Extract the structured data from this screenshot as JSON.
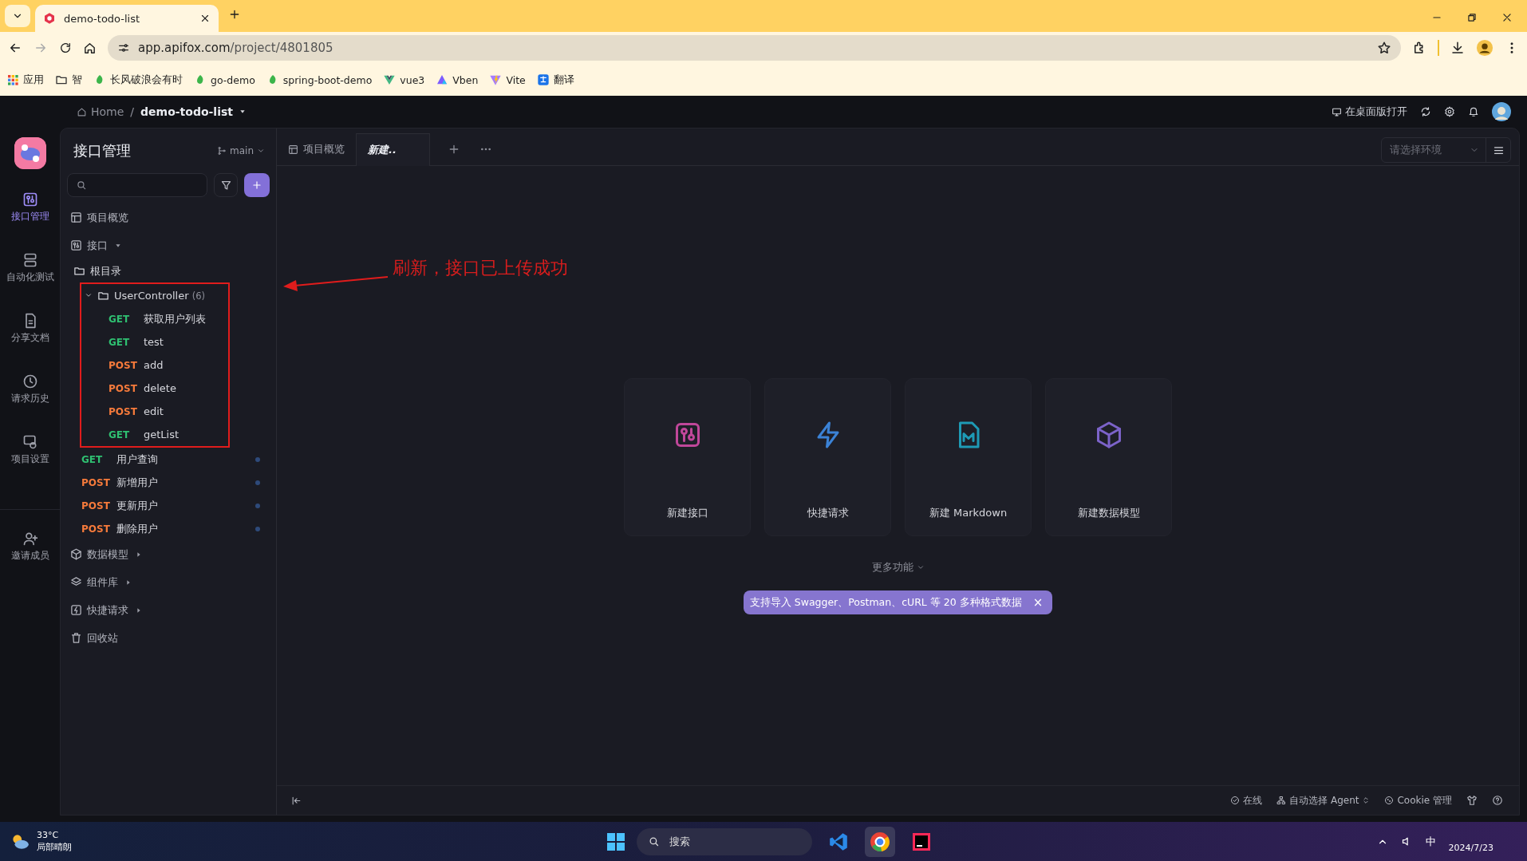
{
  "browser": {
    "tabs": [
      {
        "title": "demo-todo-list",
        "selected": true
      }
    ],
    "address": {
      "host": "app.apifox.com",
      "path": "/project/4801805"
    },
    "bookmarks": [
      {
        "label": "应用",
        "kind": "apps"
      },
      {
        "label": "智",
        "kind": "folder"
      },
      {
        "label": "长风破浪会有时",
        "kind": "leaf"
      },
      {
        "label": "go-demo",
        "kind": "leaf"
      },
      {
        "label": "spring-boot-demo",
        "kind": "leaf"
      },
      {
        "label": "vue3",
        "kind": "vue"
      },
      {
        "label": "Vben",
        "kind": "vben"
      },
      {
        "label": "Vite",
        "kind": "vite"
      },
      {
        "label": "翻译",
        "kind": "translate"
      }
    ]
  },
  "header": {
    "home": "Home",
    "separator": "/",
    "project": "demo-todo-list",
    "open_desktop": "在桌面版打开"
  },
  "rail": [
    {
      "label": "接口管理",
      "selected": true
    },
    {
      "label": "自动化测试",
      "selected": false
    },
    {
      "label": "分享文档",
      "selected": false
    },
    {
      "label": "请求历史",
      "selected": false
    },
    {
      "label": "项目设置",
      "selected": false
    },
    {
      "label": "邀请成员",
      "selected": false
    }
  ],
  "panel": {
    "title": "接口管理",
    "branch": "main",
    "nav": [
      {
        "label": "项目概览"
      },
      {
        "label": "接口",
        "expanded": true,
        "tree": [
          {
            "label": "根目录",
            "kind": "folder",
            "children": [
              {
                "label": "UserController",
                "count": "(6)",
                "kind": "folder",
                "expanded": true,
                "highlighted": true,
                "children": [
                  {
                    "kind": "endpoint",
                    "method": "GET",
                    "color": "#2fbf71",
                    "label": "获取用户列表",
                    "marked": false
                  },
                  {
                    "kind": "endpoint",
                    "method": "GET",
                    "color": "#2fbf71",
                    "label": "test",
                    "marked": false
                  },
                  {
                    "kind": "endpoint",
                    "method": "POST",
                    "color": "#f57a3b",
                    "label": "add",
                    "marked": false
                  },
                  {
                    "kind": "endpoint",
                    "method": "POST",
                    "color": "#f57a3b",
                    "label": "delete",
                    "marked": false
                  },
                  {
                    "kind": "endpoint",
                    "method": "POST",
                    "color": "#f57a3b",
                    "label": "edit",
                    "marked": false
                  },
                  {
                    "kind": "endpoint",
                    "method": "GET",
                    "color": "#2fbf71",
                    "label": "getList",
                    "marked": false
                  }
                ]
              },
              {
                "kind": "endpoint",
                "method": "GET",
                "color": "#2fbf71",
                "label": "用户查询",
                "marked": true
              },
              {
                "kind": "endpoint",
                "method": "POST",
                "color": "#f57a3b",
                "label": "新增用户",
                "marked": true
              },
              {
                "kind": "endpoint",
                "method": "POST",
                "color": "#f57a3b",
                "label": "更新用户",
                "marked": true
              },
              {
                "kind": "endpoint",
                "method": "POST",
                "color": "#f57a3b",
                "label": "删除用户",
                "marked": true
              }
            ]
          }
        ]
      },
      {
        "label": "数据模型",
        "expanded": false
      },
      {
        "label": "组件库",
        "expanded": false
      },
      {
        "label": "快捷请求",
        "expanded": false
      },
      {
        "label": "回收站"
      }
    ]
  },
  "main": {
    "tabs": [
      {
        "label": "项目概览",
        "kind": "page",
        "selected": false
      },
      {
        "label": "新建..",
        "kind": "draft",
        "selected": true
      }
    ],
    "environment": {
      "placeholder": "请选择环境"
    },
    "cards": [
      {
        "label": "新建接口",
        "color": "#c0479a"
      },
      {
        "label": "快捷请求",
        "color": "#3b82d6"
      },
      {
        "label": "新建 Markdown",
        "color": "#1e9ab5"
      },
      {
        "label": "新建数据模型",
        "color": "#7c63c9"
      }
    ],
    "more": "更多功能",
    "tip": {
      "text": "支持导入 Swagger、Postman、cURL 等 20 多种格式数据",
      "close": "×"
    },
    "status": {
      "online": "在线",
      "agent": "自动选择 Agent",
      "cookie": "Cookie 管理"
    }
  },
  "annotation": {
    "text": "刷新，接口已上传成功"
  },
  "taskbar": {
    "temperature": "33°C",
    "weather": "局部晴朗",
    "search": "搜索",
    "ime": "中",
    "date": "2024/7/23"
  }
}
